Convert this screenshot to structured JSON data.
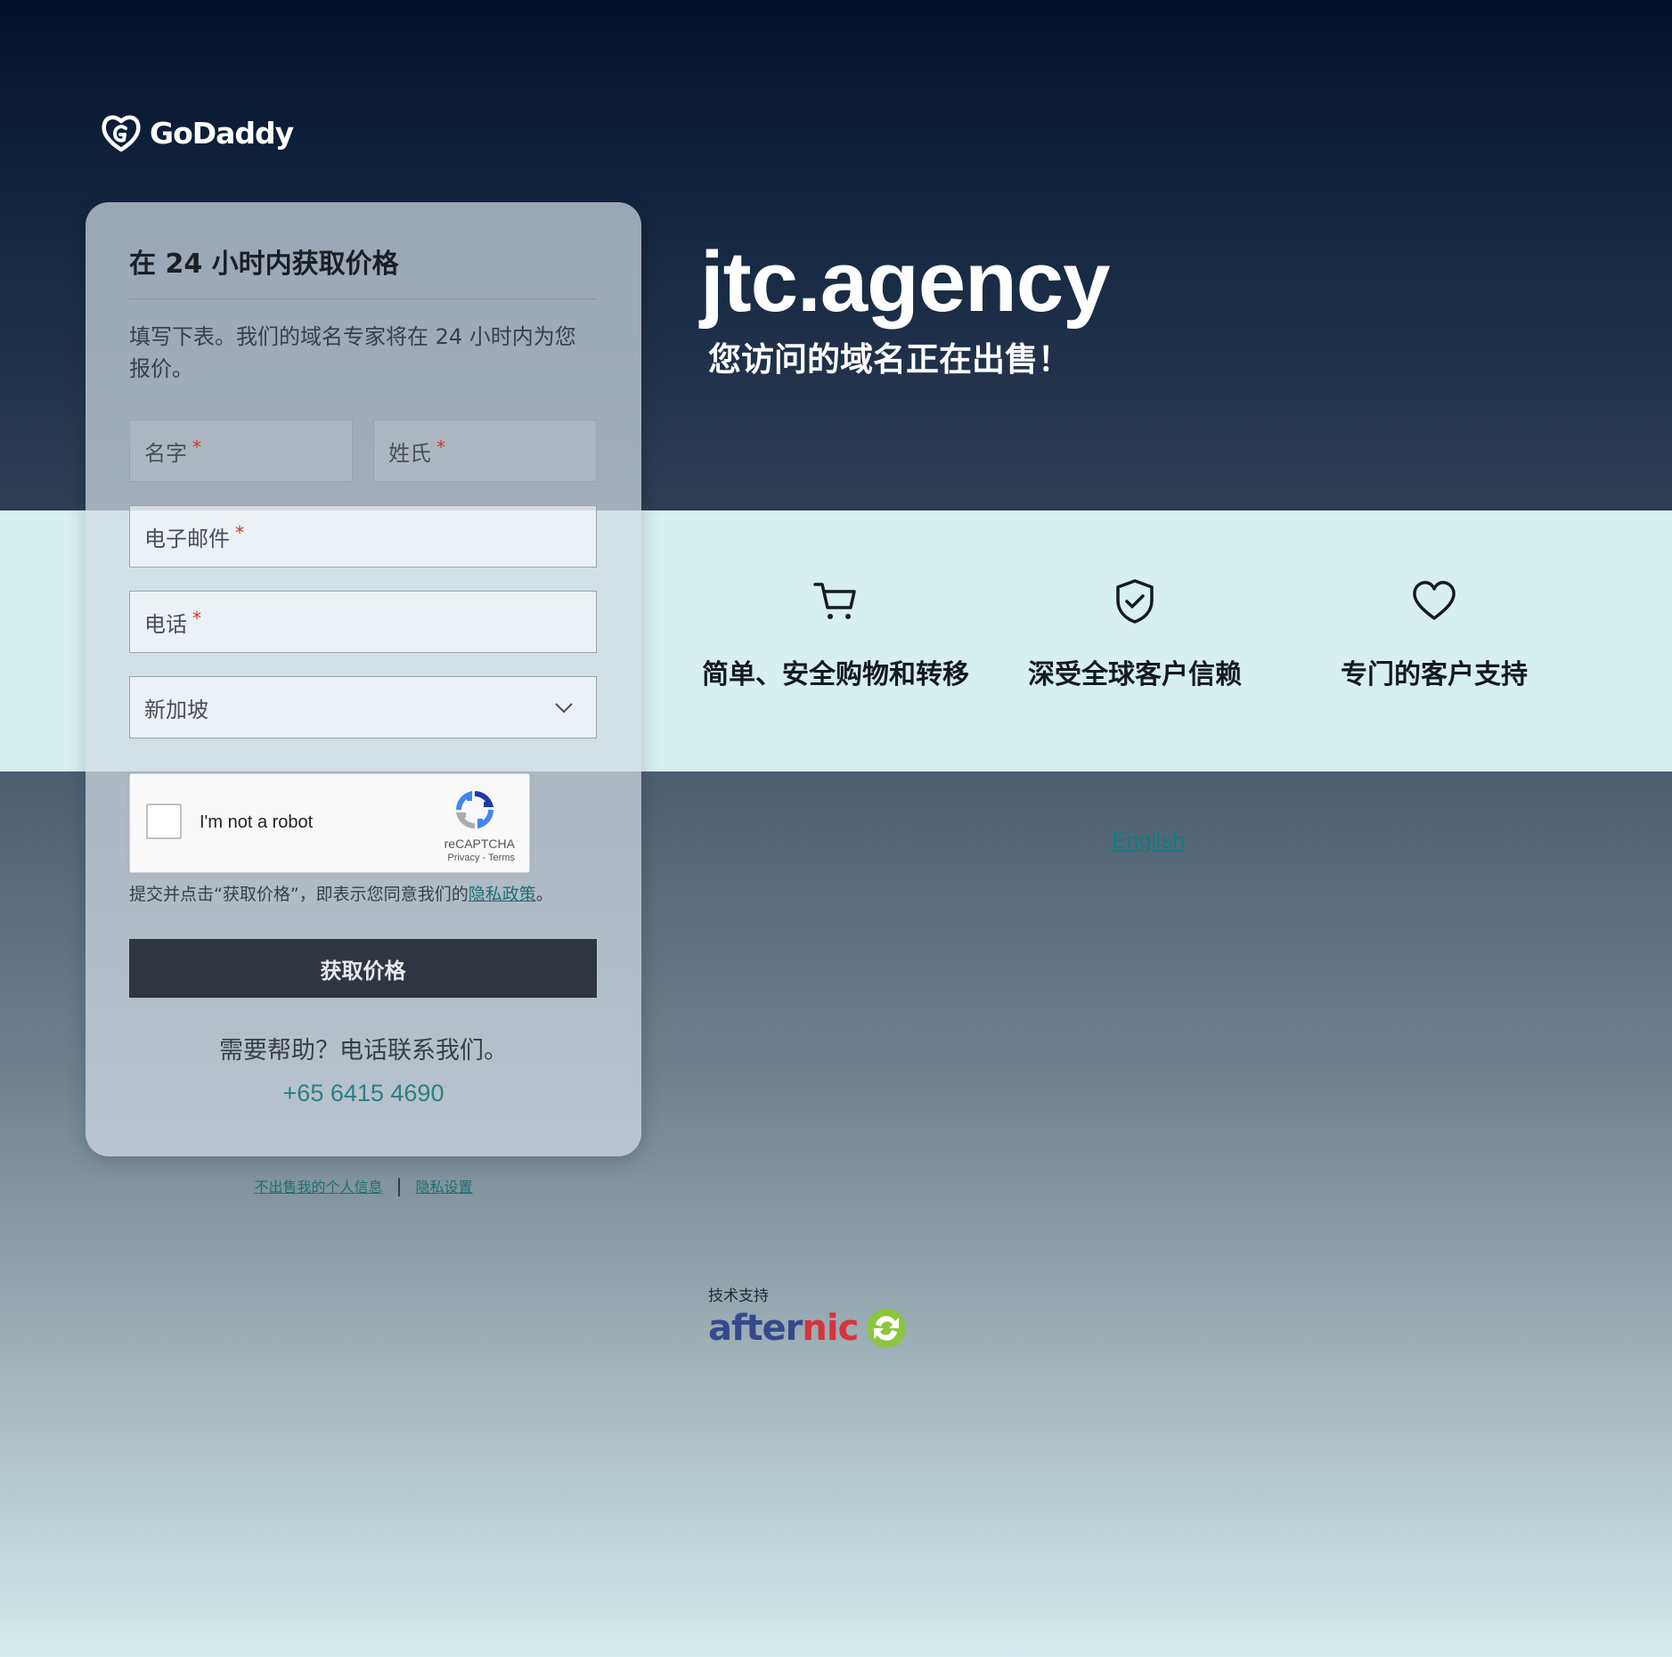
{
  "brand": {
    "logo_text": "GoDaddy",
    "logo_icon": "godaddy-heart-logo"
  },
  "form": {
    "title": "在 24 小时内获取价格",
    "description": "填写下表。我们的域名专家将在 24 小时内为您报价。",
    "fields": {
      "first_name_placeholder": "名字",
      "last_name_placeholder": "姓氏",
      "email_placeholder": "电子邮件",
      "phone_placeholder": "电话",
      "required_marker": "*"
    },
    "country_select": {
      "selected": "新加坡",
      "icon": "chevron-down-icon"
    },
    "recaptcha": {
      "label": "I'm not a robot",
      "brand": "reCAPTCHA",
      "privacy": "Privacy",
      "separator": " - ",
      "terms": "Terms"
    },
    "consent_prefix": "提交并点击“获取价格”，即表示您同意我们的",
    "consent_link": "隐私政策",
    "consent_suffix": "。",
    "submit_label": "获取价格",
    "help_text": "需要帮助？电话联系我们。",
    "phone_number": "+65 6415 4690"
  },
  "footer_links": {
    "do_not_sell": "不出售我的个人信息",
    "separator": "|",
    "privacy_settings": "隐私设置"
  },
  "hero": {
    "domain": "jtc.agency",
    "subtitle": "您访问的域名正在出售！"
  },
  "features": [
    {
      "icon": "shopping-cart-icon",
      "label": "简单、安全购物和转移"
    },
    {
      "icon": "shield-check-icon",
      "label": "深受全球客户信赖"
    },
    {
      "icon": "heart-icon",
      "label": "专门的客户支持"
    }
  ],
  "language_link": "English",
  "powered_by": {
    "label": "技术支持",
    "brand_part1": "after",
    "brand_part2": "nic",
    "icon": "afternic-arrows-logo"
  },
  "colors": {
    "accent_teal": "#2a7f86",
    "button_dark": "#30363f",
    "band": "#d6efef",
    "required_red": "#d0362a"
  }
}
